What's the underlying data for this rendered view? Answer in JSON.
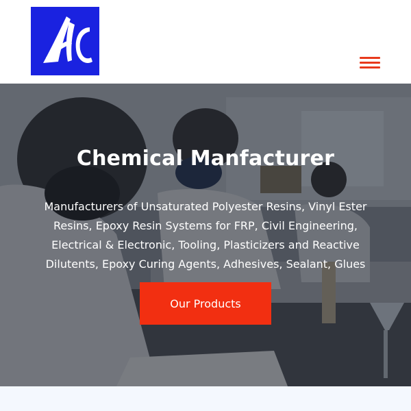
{
  "brand": {
    "logo_icon": "company-logo-monogram",
    "logo_bg": "#1a22e0"
  },
  "header": {
    "menu_icon": "hamburger-menu-icon",
    "accent": "#e8391c"
  },
  "hero": {
    "title": "Chemical Manfacturer",
    "description": "Manufacturers of Unsaturated Polyester Resins, Vinyl Ester Resins, Epoxy Resin Systems for FRP, Civil Engineering, Electrical & Electronic, Tooling, Plasticizers and Reactive Dilutents, Epoxy Curing Agents, Adhesives, Sealant, Glues",
    "cta_label": "Our Products",
    "cta_color": "#f22f11",
    "background_image": "laboratory-students-photo"
  },
  "section_below_bg": "#f4f8fe"
}
